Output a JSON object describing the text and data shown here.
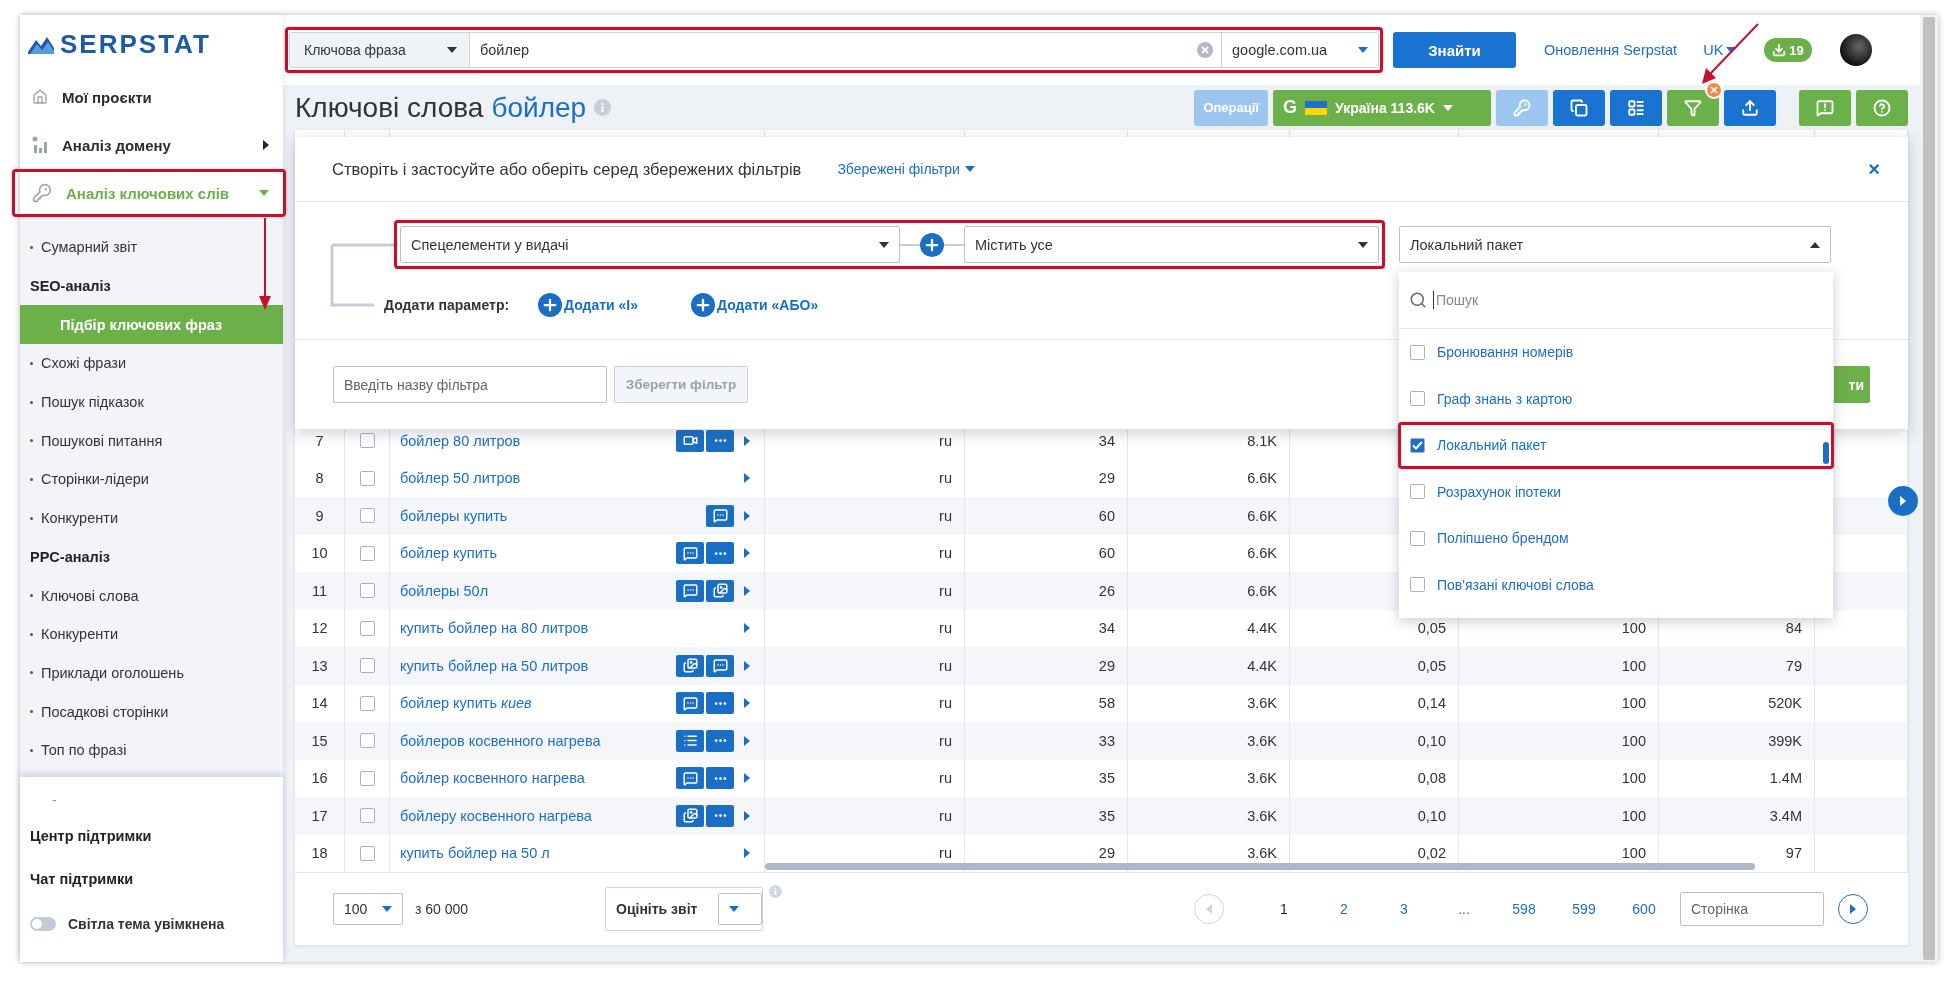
{
  "sidebar": {
    "logo": "SERPSTAT",
    "nav": [
      {
        "kind": "link",
        "label": "Мої проєкти",
        "selected": false,
        "highlighted": false
      },
      {
        "kind": "group",
        "label": "Аналіз домену",
        "expanded": false,
        "selected": false,
        "highlighted": false
      },
      {
        "kind": "group",
        "label": "Аналіз ключових слів",
        "expanded": true,
        "selected": true,
        "highlighted": true
      }
    ],
    "submenu": [
      {
        "kind": "item",
        "label": "Сумарний звіт",
        "selected": false
      },
      {
        "kind": "heading",
        "label": "SEO-аналіз"
      },
      {
        "kind": "item",
        "label": "Підбір ключових фраз",
        "selected": true
      },
      {
        "kind": "item",
        "label": "Схожі фрази",
        "selected": false
      },
      {
        "kind": "item",
        "label": "Пошук підказок",
        "selected": false
      },
      {
        "kind": "item",
        "label": "Пошукові питання",
        "selected": false
      },
      {
        "kind": "item",
        "label": "Сторінки-лідери",
        "selected": false
      },
      {
        "kind": "item",
        "label": "Конкуренти",
        "selected": false
      },
      {
        "kind": "heading",
        "label": "PPC-аналіз"
      },
      {
        "kind": "item",
        "label": "Ключові слова",
        "selected": false
      },
      {
        "kind": "item",
        "label": "Конкуренти",
        "selected": false
      },
      {
        "kind": "item",
        "label": "Приклади оголошень",
        "selected": false
      },
      {
        "kind": "item",
        "label": "Посадкові сторінки",
        "selected": false
      },
      {
        "kind": "item",
        "label": "Топ по фразі",
        "selected": false
      }
    ],
    "dash": "-",
    "links": [
      "Центр підтримки",
      "Чат підтримки"
    ],
    "theme_toggle": {
      "label": "Світла тема увімкнена",
      "on": false
    }
  },
  "header": {
    "search": {
      "type": "Ключова фраза",
      "query": "бойлер",
      "engine": "google.com.ua",
      "highlighted": true
    },
    "search_button": "Знайти",
    "updates_link": "Оновлення Serpstat",
    "language": "UK",
    "downloads": "19"
  },
  "title": {
    "text": "Ключові слова",
    "query": "бойлер"
  },
  "toolbar": {
    "operations": "Операції",
    "region": {
      "engine": "G",
      "label": "Україна 113.6K"
    },
    "filter_applied": true
  },
  "filter": {
    "title": "Створіть і застосуйте або оберіть серед збережених фільтрів",
    "saved_link": "Збережені фільтри",
    "close": "×",
    "condition": {
      "parameter": "Спецелементи у видачі",
      "operator": "Містить усе",
      "highlighted": true
    },
    "value": {
      "text": "Локальний пакет",
      "expanded": true
    },
    "add_label": "Додати параметр:",
    "add_and": "Додати «І»",
    "add_or": "Додати «АБО»",
    "name_placeholder": "Введіть назву фільтра",
    "save_button": {
      "label": "Зберегти фільтр",
      "disabled": true
    },
    "apply_button": "ти",
    "dropdown": {
      "search_placeholder": "Пошук",
      "options": [
        {
          "label": "Бронювання номерів",
          "checked": false,
          "highlighted": false
        },
        {
          "label": "Граф знань з картою",
          "checked": false,
          "highlighted": false
        },
        {
          "label": "Локальний пакет",
          "checked": true,
          "highlighted": true
        },
        {
          "label": "Розрахунок іпотеки",
          "checked": false,
          "highlighted": false
        },
        {
          "label": "Поліпшено брендом",
          "checked": false,
          "highlighted": false
        },
        {
          "label": "Пов'язані ключові слова",
          "checked": false,
          "highlighted": false
        }
      ]
    }
  },
  "table": {
    "rows": [
      {
        "index": "7",
        "checked": false,
        "keyword": "бойлер 80 литров",
        "badges": [
          {
            "kind": "video"
          },
          {
            "kind": "more"
          }
        ],
        "cells": [
          "ru",
          "34",
          "8.1K"
        ]
      },
      {
        "index": "8",
        "checked": false,
        "keyword": "бойлер 50 литров",
        "cells": [
          "ru",
          "29",
          "6.6K"
        ]
      },
      {
        "index": "9",
        "checked": false,
        "keyword": "бойлеры купить",
        "badges": [
          {
            "kind": "chat"
          }
        ],
        "cells": [
          "ru",
          "60",
          "6.6K"
        ]
      },
      {
        "index": "10",
        "checked": false,
        "keyword": "бойлер купить",
        "badges": [
          {
            "kind": "chat"
          },
          {
            "kind": "more"
          }
        ],
        "cells": [
          "ru",
          "60",
          "6.6K"
        ]
      },
      {
        "index": "11",
        "checked": false,
        "keyword": "бойлеры 50л",
        "badges": [
          {
            "kind": "chat"
          },
          {
            "kind": "image"
          }
        ],
        "cells": [
          "ru",
          "26",
          "6.6K"
        ]
      },
      {
        "index": "12",
        "checked": false,
        "keyword": "купить бойлер на 80 литров",
        "cells": [
          "ru",
          "34",
          "4.4K",
          "0,05",
          "100",
          "84"
        ]
      },
      {
        "index": "13",
        "checked": false,
        "keyword": "купить бойлер на 50 литров",
        "badges": [
          {
            "kind": "image"
          },
          {
            "kind": "chat"
          }
        ],
        "cells": [
          "ru",
          "29",
          "4.4K",
          "0,05",
          "100",
          "79"
        ]
      },
      {
        "index": "14",
        "checked": false,
        "keyword": "бойлер купить *киев*",
        "badges": [
          {
            "kind": "chat"
          },
          {
            "kind": "more"
          }
        ],
        "cells": [
          "ru",
          "58",
          "3.6K",
          "0,14",
          "100",
          "520K"
        ]
      },
      {
        "index": "15",
        "checked": false,
        "keyword": "бойлеров косвенного нагрева",
        "badges": [
          {
            "kind": "text"
          },
          {
            "kind": "more"
          }
        ],
        "cells": [
          "ru",
          "33",
          "3.6K",
          "0,10",
          "100",
          "399K"
        ]
      },
      {
        "index": "16",
        "checked": false,
        "keyword": "бойлер косвенного нагрева",
        "badges": [
          {
            "kind": "chat"
          },
          {
            "kind": "more"
          }
        ],
        "cells": [
          "ru",
          "35",
          "3.6K",
          "0,08",
          "100",
          "1.4M"
        ]
      },
      {
        "index": "17",
        "checked": false,
        "keyword": "бойлеру косвенного нагрева",
        "badges": [
          {
            "kind": "image"
          },
          {
            "kind": "more"
          }
        ],
        "cells": [
          "ru",
          "35",
          "3.6K",
          "0,10",
          "100",
          "3.4M"
        ]
      },
      {
        "index": "18",
        "checked": false,
        "keyword": "купить бойлер на 50 л",
        "cells": [
          "ru",
          "29",
          "3.6K",
          "0,02",
          "100",
          "97"
        ]
      }
    ]
  },
  "footer": {
    "page_size": "100",
    "total": "з 60 000",
    "rating_label": "Оцініть звіт",
    "pages": [
      {
        "label": "1",
        "selected": true
      },
      {
        "label": "2",
        "selected": false
      },
      {
        "label": "3",
        "selected": false
      },
      {
        "label": "...",
        "selected": false
      },
      {
        "label": "598",
        "selected": false
      },
      {
        "label": "599",
        "selected": false
      },
      {
        "label": "600",
        "selected": false
      }
    ],
    "page_placeholder": "Сторінка"
  }
}
